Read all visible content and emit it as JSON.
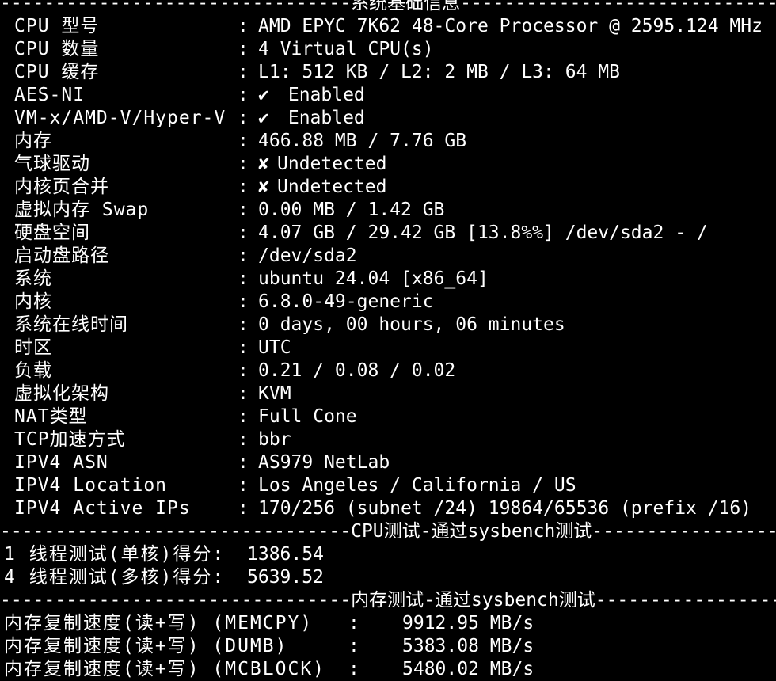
{
  "terminal": {
    "top_header": "--------------------------------系统基础信息--------------------------------",
    "system_info": [
      {
        "key": "CPU 型号",
        "value": "AMD EPYC 7K62 48-Core Processor @ 2595.124 MHz"
      },
      {
        "key": "CPU 数量",
        "value": "4 Virtual CPU(s)"
      },
      {
        "key": "CPU 缓存",
        "value": "L1: 512 KB / L2: 2 MB / L3: 64 MB"
      },
      {
        "key": "AES-NI",
        "icon": "check-icon",
        "glyph": "✔",
        "value": " Enabled"
      },
      {
        "key": "VM-x/AMD-V/Hyper-V",
        "icon": "check-icon",
        "glyph": "✔",
        "value": " Enabled"
      },
      {
        "key": "内存",
        "value": "466.88 MB / 7.76 GB"
      },
      {
        "key": "气球驱动",
        "icon": "cross-icon",
        "glyph": "✘",
        "value": "Undetected"
      },
      {
        "key": "内核页合并",
        "icon": "cross-icon",
        "glyph": "✘",
        "value": "Undetected"
      },
      {
        "key": "虚拟内存 Swap",
        "value": "0.00 MB / 1.42 GB"
      },
      {
        "key": "硬盘空间",
        "value": "4.07 GB / 29.42 GB [13.8%%] /dev/sda2 - /"
      },
      {
        "key": "启动盘路径",
        "value": "/dev/sda2"
      },
      {
        "key": "系统",
        "value": "ubuntu 24.04 [x86_64]"
      },
      {
        "key": "内核",
        "value": "6.8.0-49-generic"
      },
      {
        "key": "系统在线时间",
        "value": "0 days, 00 hours, 06 minutes"
      },
      {
        "key": "时区",
        "value": "UTC"
      },
      {
        "key": "负载",
        "value": "0.21 / 0.08 / 0.02"
      },
      {
        "key": "虚拟化架构",
        "value": "KVM"
      },
      {
        "key": "NAT类型",
        "value": "Full Cone"
      },
      {
        "key": "TCP加速方式",
        "value": "bbr"
      },
      {
        "key": "IPV4 ASN",
        "value": "AS979 NetLab"
      },
      {
        "key": "IPV4 Location",
        "value": "Los Angeles / California / US"
      },
      {
        "key": "IPV4 Active IPs",
        "value": "170/256 (subnet /24) 19864/65536 (prefix /16)"
      }
    ],
    "cpu_header": "--------------------------------CPU测试-通过sysbench测试-------------------------",
    "cpu_tests": [
      {
        "label": "1 线程测试(单核)得分:",
        "value": "1386.54"
      },
      {
        "label": "4 线程测试(多核)得分:",
        "value": "5639.52"
      }
    ],
    "mem_header": "--------------------------------内存测试-通过sysbench测试------------------------",
    "mem_tests": [
      {
        "label": "内存复制速度(读+写) (MEMCPY)",
        "value": "9912.95 MB/s"
      },
      {
        "label": "内存复制速度(读+写) (DUMB)",
        "value": "5383.08 MB/s"
      },
      {
        "label": "内存复制速度(读+写) (MCBLOCK)",
        "value": "5480.02 MB/s"
      }
    ],
    "colon": ":",
    "colors": {
      "background": "#000000",
      "text": "#ffffff"
    }
  }
}
